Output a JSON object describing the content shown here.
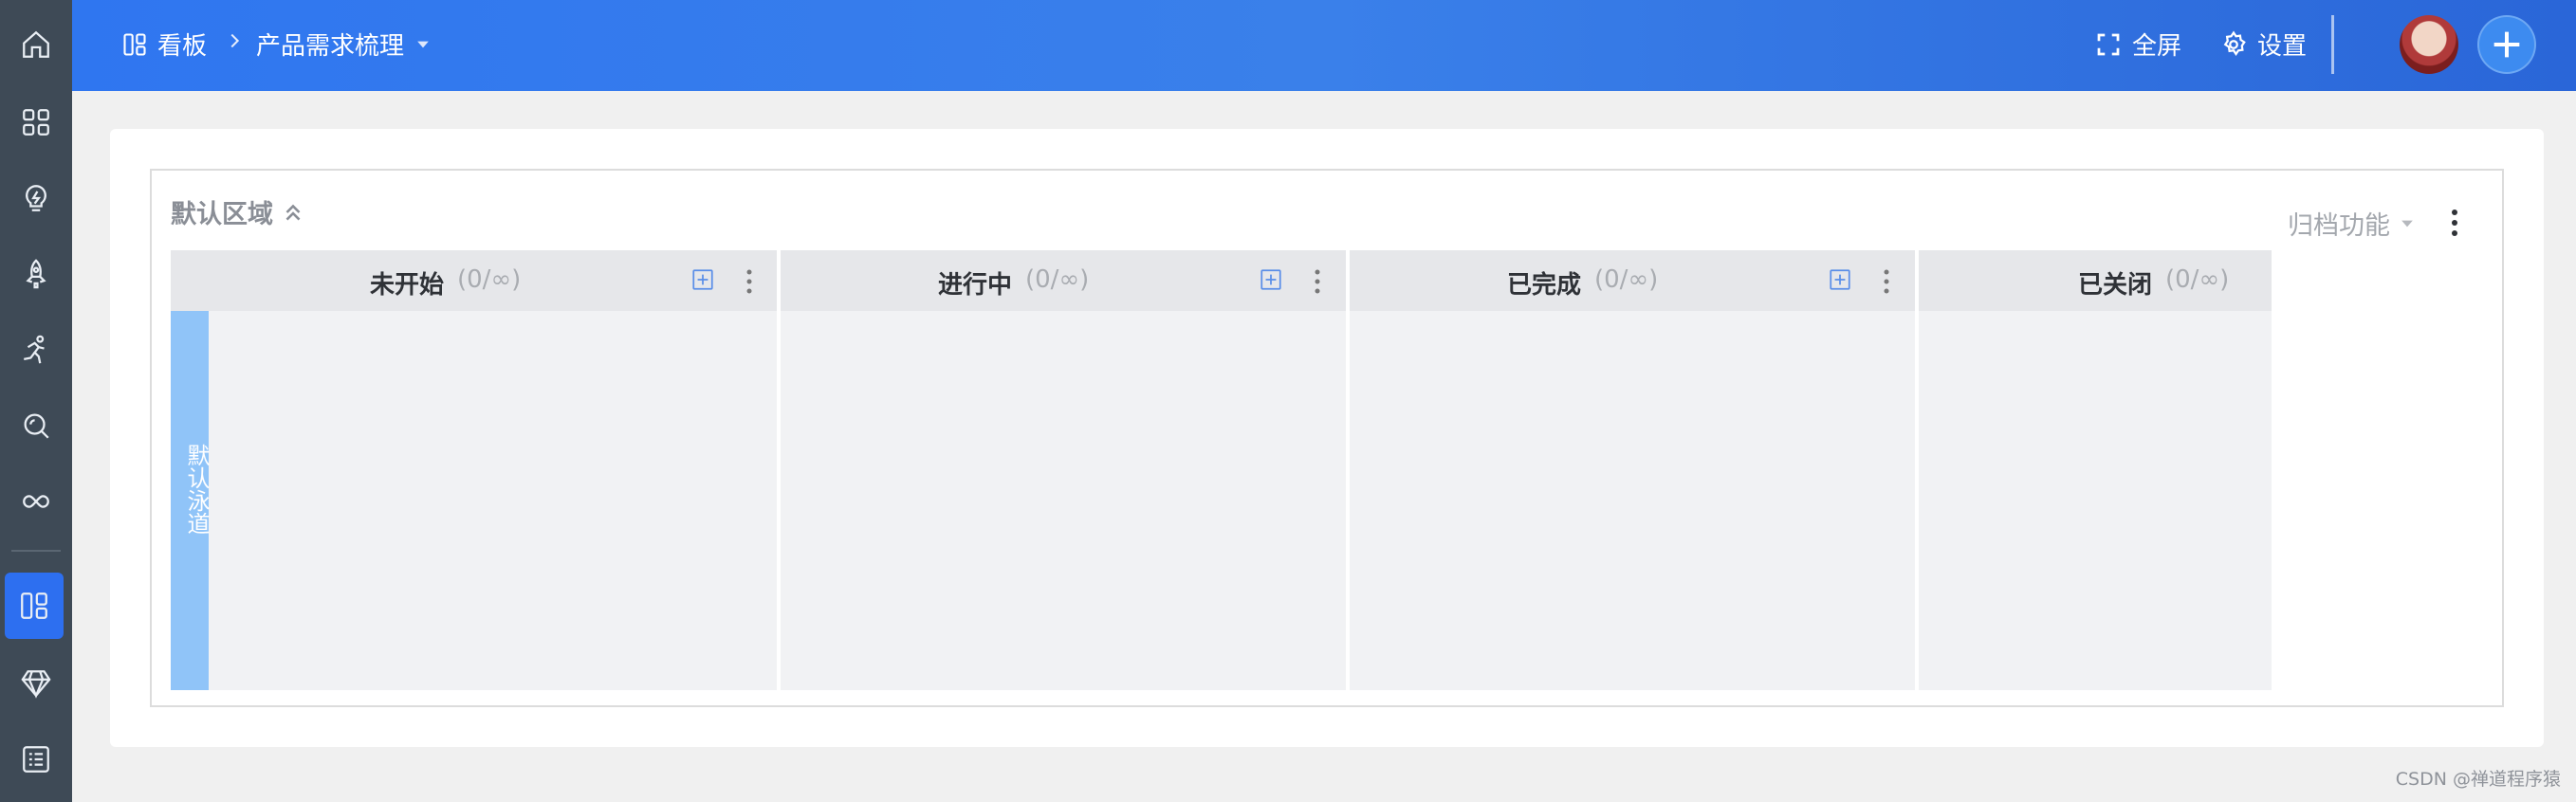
{
  "sidebar": {
    "items": [
      {
        "name": "home-icon"
      },
      {
        "name": "apps-icon"
      },
      {
        "name": "bulb-icon"
      },
      {
        "name": "rocket-icon"
      },
      {
        "name": "run-icon"
      },
      {
        "name": "search-icon"
      },
      {
        "name": "infinity-icon"
      },
      {
        "name": "board-icon",
        "active": true
      },
      {
        "name": "diamond-icon"
      },
      {
        "name": "list-icon"
      }
    ]
  },
  "header": {
    "board_label": "看板",
    "project_title": "产品需求梳理",
    "fullscreen_label": "全屏",
    "settings_label": "设置"
  },
  "region": {
    "title": "默认区域",
    "archive_label": "归档功能"
  },
  "swimlane": {
    "label": "默认泳道"
  },
  "columns": [
    {
      "title": "未开始",
      "count": "(0/∞)"
    },
    {
      "title": "进行中",
      "count": "(0/∞)"
    },
    {
      "title": "已完成",
      "count": "(0/∞)"
    },
    {
      "title": "已关闭",
      "count": "(0/∞)"
    }
  ],
  "watermark": "CSDN @禅道程序猿",
  "colors": {
    "header_start": "#2f76f0",
    "sidebar_bg": "#3e4a56",
    "active_nav": "#2d6ff0",
    "swimlane": "#90c4f8"
  }
}
